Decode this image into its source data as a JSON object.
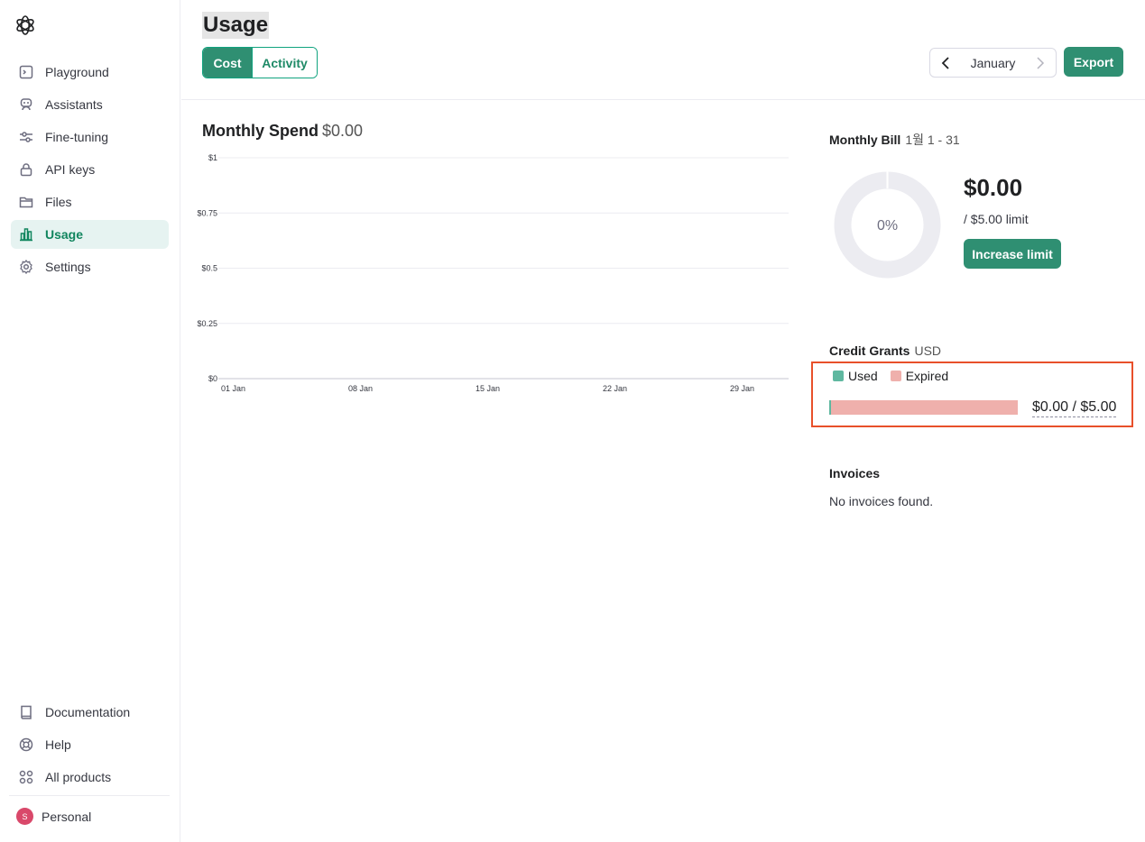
{
  "sidebar": {
    "items": [
      {
        "label": "Playground",
        "icon": "terminal-icon"
      },
      {
        "label": "Assistants",
        "icon": "robot-icon"
      },
      {
        "label": "Fine-tuning",
        "icon": "sliders-icon"
      },
      {
        "label": "API keys",
        "icon": "lock-icon"
      },
      {
        "label": "Files",
        "icon": "folder-icon"
      },
      {
        "label": "Usage",
        "icon": "bar-chart-icon",
        "active": true
      },
      {
        "label": "Settings",
        "icon": "gear-icon"
      }
    ],
    "bottom_items": [
      {
        "label": "Documentation",
        "icon": "book-icon"
      },
      {
        "label": "Help",
        "icon": "lifebuoy-icon"
      },
      {
        "label": "All products",
        "icon": "grid-icon"
      }
    ],
    "account": {
      "initial": "S",
      "name": "Personal"
    }
  },
  "header": {
    "title": "Usage",
    "tabs": [
      "Cost",
      "Activity"
    ],
    "month": "January",
    "export_label": "Export"
  },
  "spend": {
    "title": "Monthly Spend",
    "amount": "$0.00"
  },
  "chart_data": {
    "type": "bar",
    "title": "Monthly Spend",
    "x_ticks": [
      "01 Jan",
      "08 Jan",
      "15 Jan",
      "22 Jan",
      "29 Jan"
    ],
    "y_ticks": [
      "$0",
      "$0.25",
      "$0.5",
      "$0.75",
      "$1"
    ],
    "ylim": [
      0,
      1
    ],
    "values": [],
    "grid": true
  },
  "bill": {
    "title": "Monthly Bill",
    "range": "1월 1 - 31",
    "percent_label": "0%",
    "used_fraction": 0,
    "amount": "$0.00",
    "limit": "/ $5.00 limit",
    "increase_label": "Increase limit"
  },
  "credits": {
    "title": "Credit Grants",
    "currency": "USD",
    "legend_used": "Used",
    "legend_expired": "Expired",
    "used_fraction": 0,
    "summary": "$0.00 / $5.00"
  },
  "invoices": {
    "title": "Invoices",
    "empty": "No invoices found."
  },
  "colors": {
    "accent": "#2f8f72",
    "used": "#5fb8a0",
    "expired": "#efb0ac",
    "highlight": "#e8502a"
  }
}
